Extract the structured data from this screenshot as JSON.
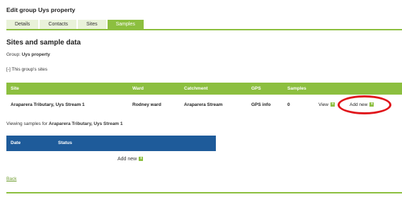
{
  "page": {
    "title": "Edit group Uys property"
  },
  "tabs": [
    {
      "label": "Details"
    },
    {
      "label": "Contacts"
    },
    {
      "label": "Sites"
    },
    {
      "label": "Samples"
    }
  ],
  "active_tab": "Samples",
  "section": {
    "title": "Sites and sample data",
    "group_prefix": "Group:",
    "group_name": "Uys property",
    "toggle_label": "[-] This group's sites"
  },
  "sites_table": {
    "headers": [
      "Site",
      "Ward",
      "Catchment",
      "GPS",
      "Samples"
    ],
    "rows": [
      {
        "site": "Araparera Tributary, Uys Stream 1",
        "ward": "Rodney ward",
        "catchment": "Araparera Stream",
        "gps": "GPS info",
        "samples": "0",
        "view_label": "View",
        "add_label": "Add new"
      }
    ]
  },
  "viewing": {
    "prefix": "Viewing samples for",
    "site": "Araparera Tributary, Uys Stream 1"
  },
  "samples_table": {
    "headers": [
      "Date",
      "Status"
    ],
    "add_label": "Add new"
  },
  "back_label": "Back",
  "colors": {
    "accent_green": "#8cbf3f",
    "table_blue": "#1e5b9a",
    "highlight_red": "#e0151b"
  }
}
